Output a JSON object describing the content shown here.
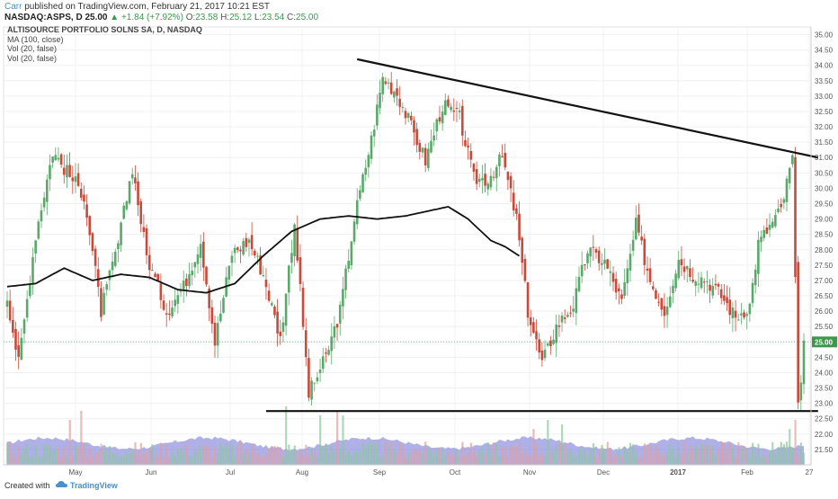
{
  "header": {
    "author": "Carr",
    "published": "published on TradingView.com, February 21, 2017 10:21 EST",
    "symbol": "NASDAQ:ASPS, D",
    "last": "25.00",
    "change": "▲ +1.84 (+7.92%)",
    "o_label": "O:",
    "o_value": "23.58",
    "h_label": "H:",
    "h_value": "25.12",
    "l_label": "L:",
    "l_value": "23.54",
    "c_label": "C:",
    "c_value": "25.00"
  },
  "indicators": {
    "title": "ALTISOURCE PORTFOLIO SOLNS SA, D, NASDAQ",
    "ma": "MA (100, close)",
    "vol1": "Vol (20, false)",
    "vol2": "Vol (20, false)"
  },
  "footer": {
    "created_with": "Created with",
    "brand": "TradingView"
  },
  "colors": {
    "up": "#5aa86a",
    "down": "#c94a3a",
    "trend": "#111111",
    "vol_area": "#6f6fd6",
    "last_price_badge": "#3a9a4a",
    "grid": "#eef0f3"
  },
  "chart_data": {
    "type": "candlestick",
    "ylim": [
      21.0,
      35.25
    ],
    "y_ticks": [
      "21.50",
      "22.00",
      "22.50",
      "23.00",
      "23.50",
      "24.00",
      "24.50",
      "25.00",
      "25.50",
      "26.00",
      "26.50",
      "27.00",
      "27.50",
      "28.00",
      "28.50",
      "29.00",
      "29.50",
      "30.00",
      "30.50",
      "31.00",
      "31.50",
      "32.00",
      "32.50",
      "33.00",
      "33.50",
      "34.00",
      "34.50",
      "35.00"
    ],
    "x_ticks": [
      "May",
      "Jun",
      "Jul",
      "Aug",
      "Sep",
      "Oct",
      "Nov",
      "Dec",
      "2017",
      "Feb",
      "27"
    ],
    "last_price_label": "25.00",
    "anchors": [
      [
        0,
        26.5
      ],
      [
        4,
        24.3
      ],
      [
        10,
        28.5
      ],
      [
        16,
        31.2
      ],
      [
        22,
        30.4
      ],
      [
        27,
        29.8
      ],
      [
        33,
        26.0
      ],
      [
        39,
        28.2
      ],
      [
        44,
        30.7
      ],
      [
        49,
        27.8
      ],
      [
        56,
        26.0
      ],
      [
        62,
        26.8
      ],
      [
        68,
        28.3
      ],
      [
        73,
        25.0
      ],
      [
        79,
        27.9
      ],
      [
        85,
        28.3
      ],
      [
        90,
        27.2
      ],
      [
        96,
        25.1
      ],
      [
        101,
        28.9
      ],
      [
        106,
        23.3
      ],
      [
        112,
        24.5
      ],
      [
        117,
        26.0
      ],
      [
        122,
        29.0
      ],
      [
        128,
        31.6
      ],
      [
        132,
        33.6
      ],
      [
        137,
        33.1
      ],
      [
        142,
        32.0
      ],
      [
        147,
        30.9
      ],
      [
        153,
        32.7
      ],
      [
        159,
        32.3
      ],
      [
        164,
        30.3
      ],
      [
        169,
        30.3
      ],
      [
        174,
        31.0
      ],
      [
        179,
        29.0
      ],
      [
        183,
        26.0
      ],
      [
        188,
        24.3
      ],
      [
        193,
        25.5
      ],
      [
        199,
        26.2
      ],
      [
        204,
        28.0
      ],
      [
        210,
        27.6
      ],
      [
        216,
        26.3
      ],
      [
        221,
        28.8
      ],
      [
        226,
        27.0
      ],
      [
        231,
        26.0
      ],
      [
        236,
        27.7
      ],
      [
        241,
        27.2
      ],
      [
        246,
        27.0
      ],
      [
        251,
        26.5
      ],
      [
        256,
        25.8
      ],
      [
        261,
        26.2
      ],
      [
        264,
        28.2
      ],
      [
        269,
        28.9
      ],
      [
        272,
        29.3
      ],
      [
        276,
        31.0
      ],
      [
        278,
        22.8
      ],
      [
        280,
        25.0
      ]
    ],
    "ma_anchors": [
      [
        0,
        26.8
      ],
      [
        10,
        26.9
      ],
      [
        20,
        27.4
      ],
      [
        30,
        27.0
      ],
      [
        40,
        27.2
      ],
      [
        50,
        27.1
      ],
      [
        60,
        26.7
      ],
      [
        70,
        26.6
      ],
      [
        80,
        26.9
      ],
      [
        90,
        27.8
      ],
      [
        100,
        28.6
      ],
      [
        110,
        29.0
      ],
      [
        120,
        29.1
      ],
      [
        130,
        29.0
      ],
      [
        140,
        29.1
      ],
      [
        150,
        29.3
      ],
      [
        155,
        29.4
      ],
      [
        162,
        29.0
      ],
      [
        170,
        28.3
      ],
      [
        175,
        28.1
      ],
      [
        180,
        27.8
      ]
    ],
    "trendline_upper": [
      [
        123,
        34.2
      ],
      [
        285,
        31.0
      ]
    ],
    "trendline_lower": [
      [
        91,
        22.75
      ],
      [
        285,
        22.75
      ]
    ]
  }
}
